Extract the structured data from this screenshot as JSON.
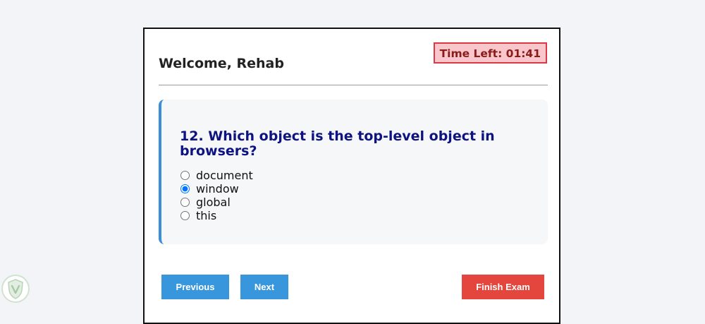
{
  "header": {
    "welcome": "Welcome, Rehab",
    "timer": "Time Left: 01:41"
  },
  "question": {
    "text": "12. Which object is the top-level object in browsers?",
    "options": [
      {
        "label": "document",
        "selected": false
      },
      {
        "label": "window",
        "selected": true
      },
      {
        "label": "global",
        "selected": false
      },
      {
        "label": "this",
        "selected": false
      }
    ]
  },
  "buttons": {
    "previous": "Previous",
    "next": "Next",
    "finish": "Finish Exam"
  },
  "colors": {
    "accent": "#3897dc",
    "danger": "#e4463d",
    "question_text": "#0d1380"
  },
  "icons": {
    "corner_logo": "shield-logo-icon"
  }
}
